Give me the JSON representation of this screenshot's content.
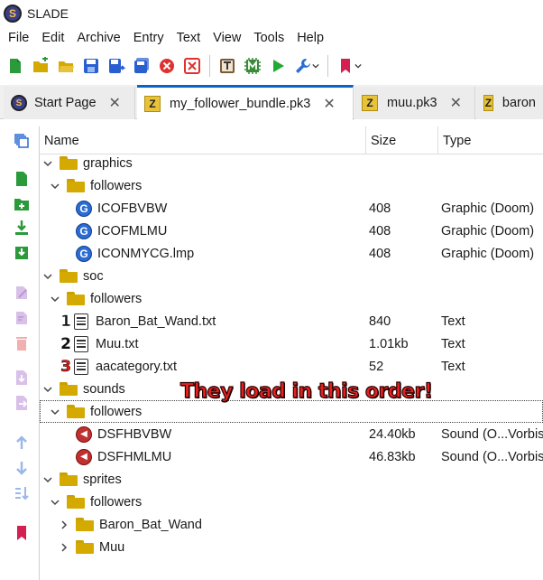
{
  "window": {
    "title": "SLADE"
  },
  "menu": [
    "File",
    "Edit",
    "Archive",
    "Entry",
    "Text",
    "View",
    "Tools",
    "Help"
  ],
  "tabs": [
    {
      "label": "Start Page"
    },
    {
      "label": "my_follower_bundle.pk3"
    },
    {
      "label": "muu.pk3"
    },
    {
      "label": "baron"
    }
  ],
  "columns": {
    "name": "Name",
    "size": "Size",
    "type": "Type"
  },
  "rows": [
    {
      "name": "graphics",
      "size": "",
      "type": ""
    },
    {
      "name": "followers",
      "size": "",
      "type": ""
    },
    {
      "name": "ICOFBVBW",
      "size": "408",
      "type": "Graphic (Doom)"
    },
    {
      "name": "ICOFMLMU",
      "size": "408",
      "type": "Graphic (Doom)"
    },
    {
      "name": "ICONMYCG.lmp",
      "size": "408",
      "type": "Graphic (Doom)"
    },
    {
      "name": "soc",
      "size": "",
      "type": ""
    },
    {
      "name": "followers",
      "size": "",
      "type": ""
    },
    {
      "name": "Baron_Bat_Wand.txt",
      "size": "840",
      "type": "Text",
      "order": "1"
    },
    {
      "name": "Muu.txt",
      "size": "1.01kb",
      "type": "Text",
      "order": "2"
    },
    {
      "name": "aacategory.txt",
      "size": "52",
      "type": "Text",
      "order": "3"
    },
    {
      "name": "sounds",
      "size": "",
      "type": ""
    },
    {
      "name": "followers",
      "size": "",
      "type": ""
    },
    {
      "name": "DSFHBVBW",
      "size": "24.40kb",
      "type": "Sound (O...Vorbis"
    },
    {
      "name": "DSFHMLMU",
      "size": "46.83kb",
      "type": "Sound (O...Vorbis"
    },
    {
      "name": "sprites",
      "size": "",
      "type": ""
    },
    {
      "name": "followers",
      "size": "",
      "type": ""
    },
    {
      "name": "Baron_Bat_Wand",
      "size": "",
      "type": ""
    },
    {
      "name": "Muu",
      "size": "",
      "type": ""
    }
  ],
  "annotation": "They load in this order!",
  "colors": {
    "accent": "#0a64c8",
    "folder": "#d4aa00",
    "annotation": "#e62020"
  }
}
